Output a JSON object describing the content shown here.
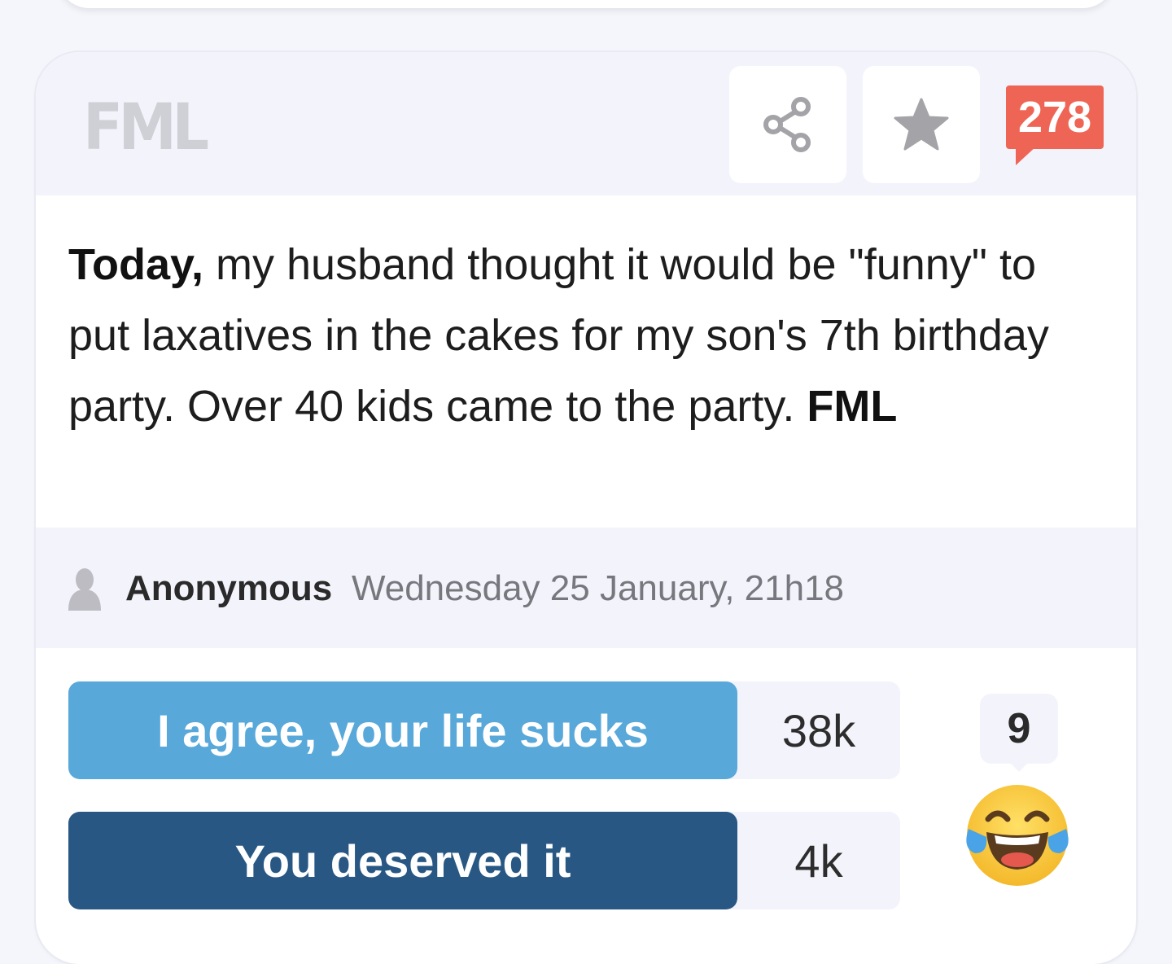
{
  "card": {
    "logo": "FML",
    "comment_count": "278",
    "story_lead": "Today,",
    "story_body": " my husband thought it would be \"funny\" to put laxatives in the cakes for my son's 7th birthday party. Over 40 kids came to the party. ",
    "story_tail": "FML",
    "author": "Anonymous",
    "date": "Wednesday 25 January, 21h18",
    "votes": [
      {
        "label": "I agree, your life sucks",
        "count": "38k"
      },
      {
        "label": "You deserved it",
        "count": "4k"
      }
    ],
    "reaction_count": "9"
  },
  "icons": {
    "share": "share-icon",
    "favorite": "star-icon",
    "avatar": "user-silhouette-icon",
    "reaction": "tears-of-joy-emoji"
  },
  "colors": {
    "agree": "#58a8da",
    "deserved": "#285784",
    "badge": "#ef6555",
    "panel": "#f3f3fb"
  }
}
